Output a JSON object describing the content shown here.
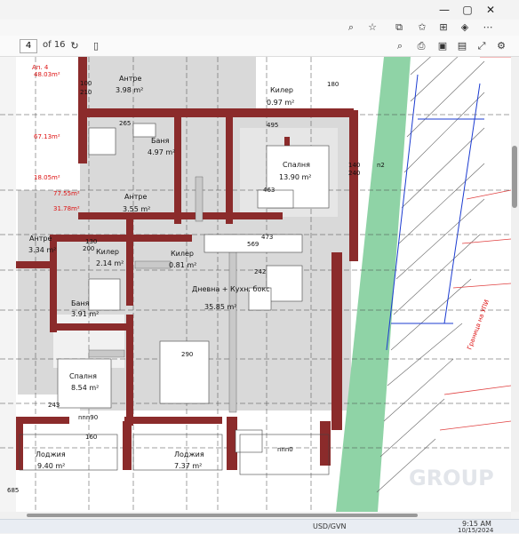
{
  "pdf_toolbar": {
    "current_page": "4",
    "total_pages": "of 16"
  },
  "rooms": [
    {
      "name": "Антре",
      "area": "3.98 m²"
    },
    {
      "name": "Килер",
      "area": "0.97 m²"
    },
    {
      "name": "Баня",
      "area": "4.97 m²"
    },
    {
      "name": "Спалня",
      "area": "13.90 m²"
    },
    {
      "name": "Антре",
      "area": "3.55 m²"
    },
    {
      "name": "Антре",
      "area": "3.34 m²"
    },
    {
      "name": "Килер",
      "area": "2.14 m²"
    },
    {
      "name": "Килер",
      "area": "0.81 m²"
    },
    {
      "name": "Дневна + Кухн. бокс",
      "area": "35.85 m²"
    },
    {
      "name": "Баня",
      "area": "3.91 m²"
    },
    {
      "name": "Спалня",
      "area": "8.54 m²"
    },
    {
      "name": "Лоджия",
      "area": "9.40 m²"
    },
    {
      "name": "Лоджия",
      "area": "7.37 m²"
    }
  ],
  "dimensions": [
    "100",
    "210",
    "265",
    "495",
    "180",
    "463",
    "473",
    "569",
    "290",
    "160",
    "130",
    "200",
    "243",
    "140",
    "240",
    "nnn90",
    "685",
    "nnn0",
    "242",
    "n2"
  ],
  "watermark": "GROUP",
  "taskbar": {
    "time": "9:15 AM",
    "date": "10/15/2024",
    "ticker": "USD/GVN"
  }
}
